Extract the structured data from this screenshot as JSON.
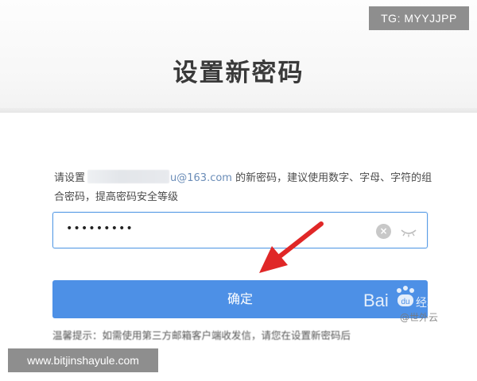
{
  "overlays": {
    "top_right_label": "TG: MYYJJPP",
    "bottom_left_label": "www.bitjinshayule.com"
  },
  "page": {
    "title": "设置新密码"
  },
  "instructions": {
    "prefix": "请设置",
    "email_domain": "u@163.com",
    "suffix": " 的新密码，建议使用数字、字母、字符的组合密码，提高密码安全等级"
  },
  "password_field": {
    "value": "•••••••••"
  },
  "icons": {
    "clear": "clear-circle-icon",
    "visibility": "eye-closed-icon",
    "pointer": "red-arrow-icon"
  },
  "confirm_button": {
    "label": "确定"
  },
  "hint": {
    "text": "温馨提示：如需使用第三方邮箱客户端收发信，请您在设置新密码后"
  },
  "watermark": {
    "brand": "Bai",
    "brand_suffix": "经验",
    "sub": "@世外云"
  },
  "colors": {
    "accent": "#4d90e6",
    "field_border": "#5a9de6",
    "arrow": "#e02727"
  }
}
